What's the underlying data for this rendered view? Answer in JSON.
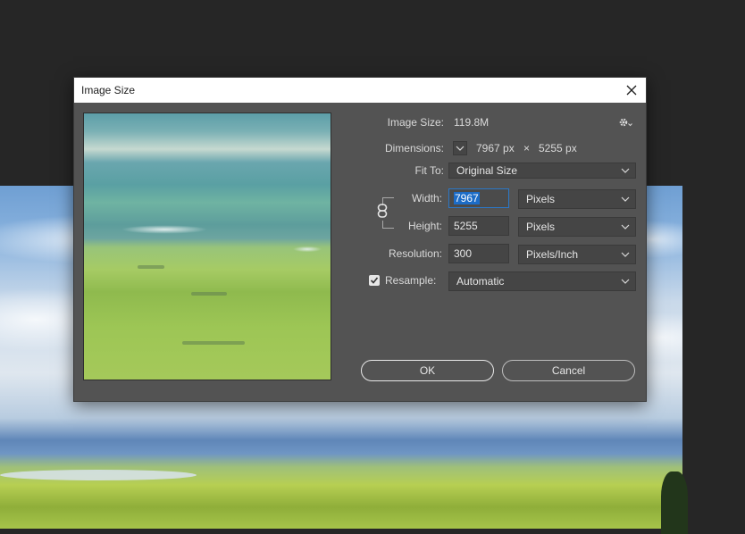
{
  "dialog": {
    "title": "Image Size"
  },
  "image_size": {
    "label": "Image Size:",
    "value": "119.8M"
  },
  "dimensions": {
    "label": "Dimensions:",
    "width": "7967 px",
    "times": "×",
    "height": "5255 px"
  },
  "fit_to": {
    "label": "Fit To:",
    "selected": "Original Size"
  },
  "width": {
    "label": "Width:",
    "value": "7967",
    "unit": "Pixels"
  },
  "height": {
    "label": "Height:",
    "value": "5255",
    "unit": "Pixels"
  },
  "resolution": {
    "label": "Resolution:",
    "value": "300",
    "unit": "Pixels/Inch"
  },
  "resample": {
    "label": "Resample:",
    "checked": true,
    "selected": "Automatic"
  },
  "buttons": {
    "ok": "OK",
    "cancel": "Cancel"
  },
  "colors": {
    "dialog_bg": "#535353",
    "field_bg": "#454545",
    "selection": "#1c6cc7",
    "focus_border": "#2b78c8"
  },
  "icons": {
    "close": "close-icon",
    "gear": "gear-icon",
    "chevron": "chevron-down-icon",
    "link": "link-chain-icon",
    "check": "checkmark-icon"
  }
}
